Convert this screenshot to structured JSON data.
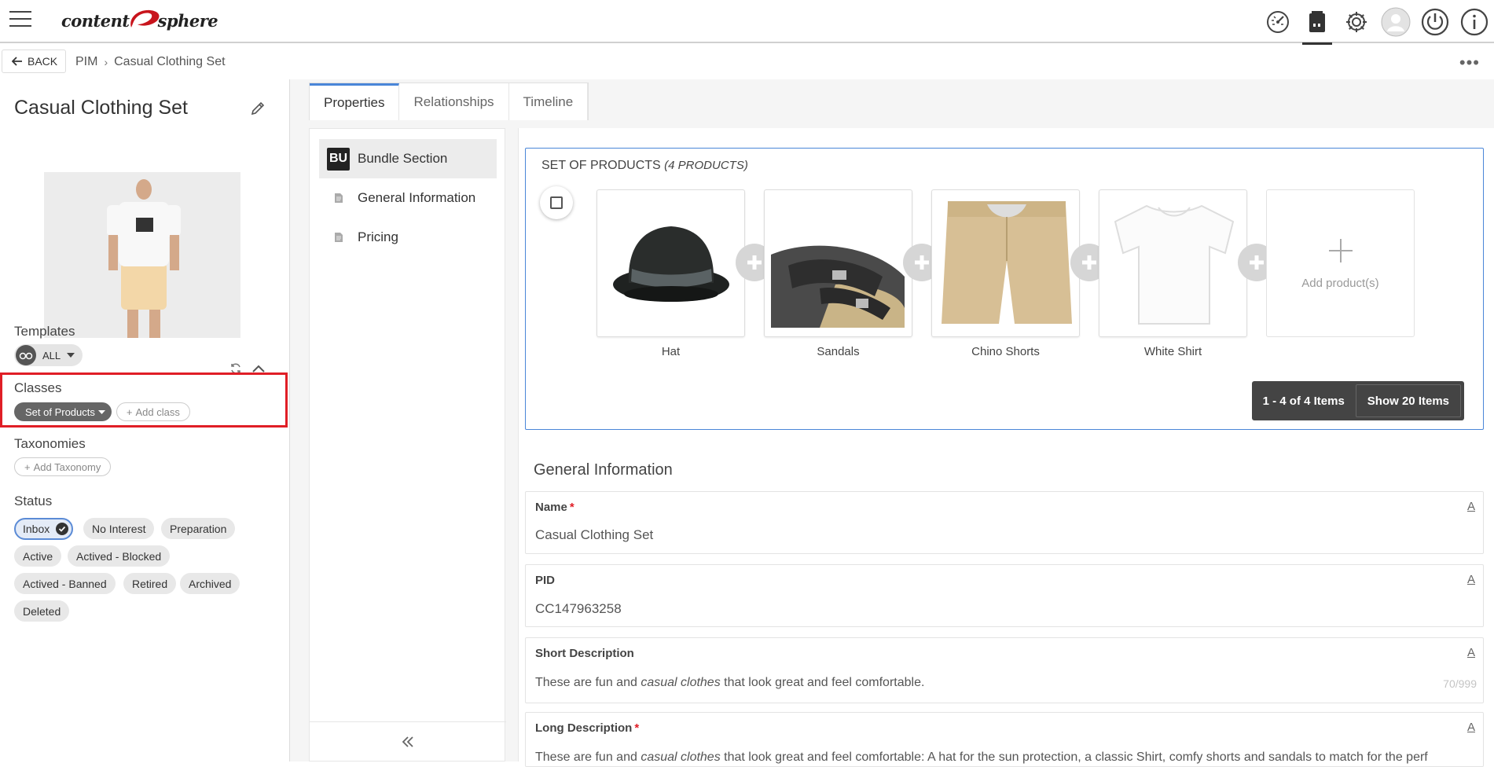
{
  "app": {
    "logo_left": "content",
    "logo_right": "sphere"
  },
  "topbar": {
    "icons": [
      "dashboard-icon",
      "product-icon",
      "settings-icon",
      "user-avatar-icon",
      "power-icon",
      "info-icon"
    ],
    "active_icon": "product-icon"
  },
  "subbar": {
    "back_label": "BACK",
    "breadcrumb": [
      "PIM",
      "Casual Clothing Set"
    ],
    "more_label": "•••"
  },
  "left": {
    "title": "Casual Clothing Set",
    "templates_label": "Templates",
    "templates_chip": "ALL",
    "classes_label": "Classes",
    "class_chip": "Set of Products",
    "add_class_label": "Add class",
    "taxonomies_label": "Taxonomies",
    "add_taxonomy_label": "Add Taxonomy",
    "status_label": "Status",
    "statuses": [
      "Inbox",
      "No Interest",
      "Preparation",
      "Active",
      "Actived - Blocked",
      "Actived - Banned",
      "Retired",
      "Archived",
      "Deleted"
    ],
    "selected_status": "Inbox"
  },
  "tabs": [
    "Properties",
    "Relationships",
    "Timeline"
  ],
  "active_tab": "Properties",
  "section_nav": {
    "items": [
      {
        "badge": "BU",
        "label": "Bundle Section"
      },
      {
        "badge": "",
        "label": "General Information"
      },
      {
        "badge": "",
        "label": "Pricing"
      }
    ]
  },
  "bundle": {
    "heading": "SET OF PRODUCTS",
    "heading_count": "(4 PRODUCTS)",
    "products": [
      "Hat",
      "Sandals",
      "Chino Shorts",
      "White Shirt"
    ],
    "add_label": "Add product(s)",
    "pager_range": "1 - 4 of 4 Items",
    "pager_show": "Show 20 Items"
  },
  "general": {
    "title": "General Information",
    "fields": [
      {
        "label": "Name",
        "required": "*",
        "value": "Casual Clothing Set"
      },
      {
        "label": "PID",
        "required": "",
        "value": "CC147963258"
      },
      {
        "label": "Short Description",
        "required": "",
        "value_pre": "These are fun and ",
        "value_em": "casual clothes",
        "value_post": " that look great and feel comfortable.",
        "counter": "70/999"
      },
      {
        "label": "Long Description",
        "required": "*",
        "value_pre": "These are fun and ",
        "value_em": "casual clothes",
        "value_post": " that look great and feel comfortable: A hat for the sun protection, a classic Shirt, comfy shorts and sandals to match for the perf"
      }
    ],
    "lock_glyph": "A"
  },
  "colors": {
    "accent": "#4a86d8",
    "highlight": "#e01e26",
    "logo_red": "#c8141c"
  }
}
